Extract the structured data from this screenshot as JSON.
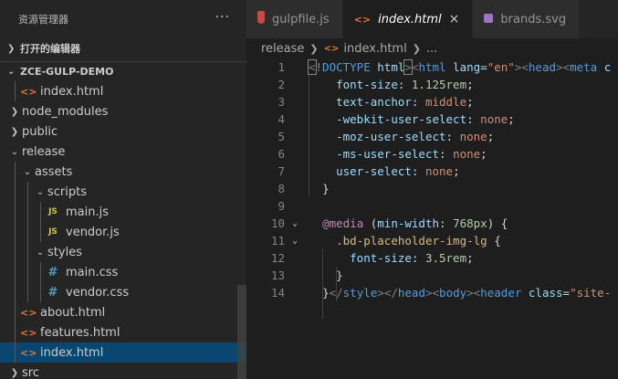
{
  "explorer": {
    "title": "资源管理器",
    "more": "···",
    "open_editors": "打开的编辑器",
    "project": "ZCE-GULP-DEMO",
    "tree": [
      {
        "label": "index.html",
        "kind": "html",
        "depth": 1
      },
      {
        "label": "node_modules",
        "kind": "folder-closed",
        "depth": 0
      },
      {
        "label": "public",
        "kind": "folder-closed",
        "depth": 0
      },
      {
        "label": "release",
        "kind": "folder-open",
        "depth": 0
      },
      {
        "label": "assets",
        "kind": "folder-open",
        "depth": 1
      },
      {
        "label": "scripts",
        "kind": "folder-open",
        "depth": 2
      },
      {
        "label": "main.js",
        "kind": "js",
        "depth": 3
      },
      {
        "label": "vendor.js",
        "kind": "js",
        "depth": 3
      },
      {
        "label": "styles",
        "kind": "folder-open",
        "depth": 2
      },
      {
        "label": "main.css",
        "kind": "css",
        "depth": 3
      },
      {
        "label": "vendor.css",
        "kind": "css",
        "depth": 3
      },
      {
        "label": "about.html",
        "kind": "html",
        "depth": 1
      },
      {
        "label": "features.html",
        "kind": "html",
        "depth": 1
      },
      {
        "label": "index.html",
        "kind": "html",
        "depth": 1,
        "selected": true
      },
      {
        "label": "src",
        "kind": "folder-closed",
        "depth": 0
      }
    ],
    "icons": {
      "html": "<>",
      "js": "JS",
      "css": "#"
    }
  },
  "tabs": [
    {
      "label": "gulpfile.js",
      "icon": "gulp-icon",
      "active": false
    },
    {
      "label": "index.html",
      "icon": "html-icon",
      "active": true,
      "close": "×"
    },
    {
      "label": "brands.svg",
      "icon": "svg-icon",
      "active": false
    }
  ],
  "breadcrumb": {
    "folder": "release",
    "file": "index.html",
    "rest": "..."
  },
  "code_lines": [
    {
      "n": "1",
      "fold": "",
      "html": "<span class=\"t-punc bracket\">&lt;</span><span class=\"t-tag\">!DOCTYPE</span> <span class=\"t-attr\">html</span><span class=\"t-punc bracket\">&gt;</span><span class=\"t-punc\">&lt;</span><span class=\"t-tag\">html</span> <span class=\"t-attr\">lang</span><span class=\"t-plain\">=</span><span class=\"t-str\">\"en\"</span><span class=\"t-punc\">&gt;&lt;</span><span class=\"t-tag\">head</span><span class=\"t-punc\">&gt;&lt;</span><span class=\"t-tag\">meta</span> <span class=\"t-attr\">c</span>"
    },
    {
      "n": "2",
      "fold": "",
      "html": "    <span class=\"t-prop\">font-size</span><span class=\"t-plain\">: </span><span class=\"t-num\">1.125rem</span><span class=\"t-plain\">;</span>"
    },
    {
      "n": "3",
      "fold": "",
      "html": "    <span class=\"t-prop\">text-anchor</span><span class=\"t-plain\">: </span><span class=\"t-val\">middle</span><span class=\"t-plain\">;</span>"
    },
    {
      "n": "4",
      "fold": "",
      "html": "    <span class=\"t-prop\">-webkit-user-select</span><span class=\"t-plain\">: </span><span class=\"t-val\">none</span><span class=\"t-plain\">;</span>"
    },
    {
      "n": "5",
      "fold": "",
      "html": "    <span class=\"t-prop\">-moz-user-select</span><span class=\"t-plain\">: </span><span class=\"t-val\">none</span><span class=\"t-plain\">;</span>"
    },
    {
      "n": "6",
      "fold": "",
      "html": "    <span class=\"t-prop\">-ms-user-select</span><span class=\"t-plain\">: </span><span class=\"t-val\">none</span><span class=\"t-plain\">;</span>"
    },
    {
      "n": "7",
      "fold": "",
      "html": "    <span class=\"t-prop\">user-select</span><span class=\"t-plain\">: </span><span class=\"t-val\">none</span><span class=\"t-plain\">;</span>"
    },
    {
      "n": "8",
      "fold": "",
      "html": "  <span class=\"t-plain\">}</span>"
    },
    {
      "n": "9",
      "fold": "",
      "html": ""
    },
    {
      "n": "10",
      "fold": "⌄",
      "html": "  <span class=\"t-at\">@media</span> <span class=\"t-plain\">(</span><span class=\"t-prop\">min-width</span><span class=\"t-plain\">: </span><span class=\"t-num\">768px</span><span class=\"t-plain\">) {</span>"
    },
    {
      "n": "11",
      "fold": "⌄",
      "html": "    <span class=\"t-sel\">.bd-placeholder-img-lg</span> <span class=\"t-plain\">{</span>"
    },
    {
      "n": "12",
      "fold": "",
      "html": "      <span class=\"t-prop\">font-size</span><span class=\"t-plain\">: </span><span class=\"t-num\">3.5rem</span><span class=\"t-plain\">;</span>"
    },
    {
      "n": "13",
      "fold": "",
      "html": "    <span class=\"t-plain\">}</span>"
    },
    {
      "n": "14",
      "fold": "",
      "html": "  <span class=\"t-plain\">}</span><span class=\"t-punc\">&lt;/</span><span class=\"t-tag\">style</span><span class=\"t-punc\">&gt;&lt;/</span><span class=\"t-tag\">head</span><span class=\"t-punc\">&gt;&lt;</span><span class=\"t-tag\">body</span><span class=\"t-punc\">&gt;&lt;</span><span class=\"t-tag\">header</span> <span class=\"t-attr\">class</span><span class=\"t-plain\">=</span><span class=\"t-str\">\"site-</span>"
    }
  ],
  "colors": {
    "sidebar_bg": "#252526",
    "editor_bg": "#1e1e1e",
    "selection": "#094771",
    "html_icon": "#e37933",
    "js_icon": "#cbcb41",
    "css_icon": "#519aba"
  }
}
